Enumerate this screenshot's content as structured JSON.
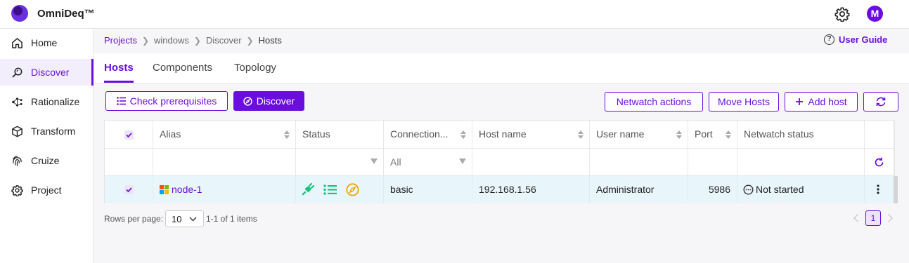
{
  "app": {
    "name": "OmniDeq™",
    "avatar_initial": "M"
  },
  "sidebar": {
    "items": [
      {
        "label": "Home",
        "icon": "home-icon"
      },
      {
        "label": "Discover",
        "icon": "discover-icon",
        "active": true
      },
      {
        "label": "Rationalize",
        "icon": "rationalize-icon"
      },
      {
        "label": "Transform",
        "icon": "cube-icon"
      },
      {
        "label": "Cruize",
        "icon": "fingerprint-icon"
      },
      {
        "label": "Project",
        "icon": "gear-icon"
      }
    ]
  },
  "breadcrumb": [
    "Projects",
    "windows",
    "Discover",
    "Hosts"
  ],
  "user_guide": "User Guide",
  "tabs": [
    "Hosts",
    "Components",
    "Topology"
  ],
  "toolbar": {
    "check_prereq": "Check prerequisites",
    "discover": "Discover",
    "netwatch_actions": "Netwatch actions",
    "move_hosts": "Move Hosts",
    "add_host": "Add host"
  },
  "table": {
    "columns": [
      "Alias",
      "Status",
      "Connection...",
      "Host name",
      "User name",
      "Port",
      "Netwatch status"
    ],
    "filter_all": "All",
    "rows": [
      {
        "alias": "node-1",
        "status_icons": [
          "plug-icon",
          "list-icon",
          "compass-icon"
        ],
        "connection": "basic",
        "host_name": "192.168.1.56",
        "user_name": "Administrator",
        "port": "5986",
        "netwatch_status": "Not started"
      }
    ]
  },
  "pagination": {
    "rows_per_page_label": "Rows per page:",
    "rows_per_page": "10",
    "range": "1-1 of 1 items",
    "current_page": "1"
  },
  "colors": {
    "accent": "#6a0dde",
    "row_selected": "#e8f6fb",
    "status_green": "#19c37d",
    "status_orange": "#f0a500"
  }
}
